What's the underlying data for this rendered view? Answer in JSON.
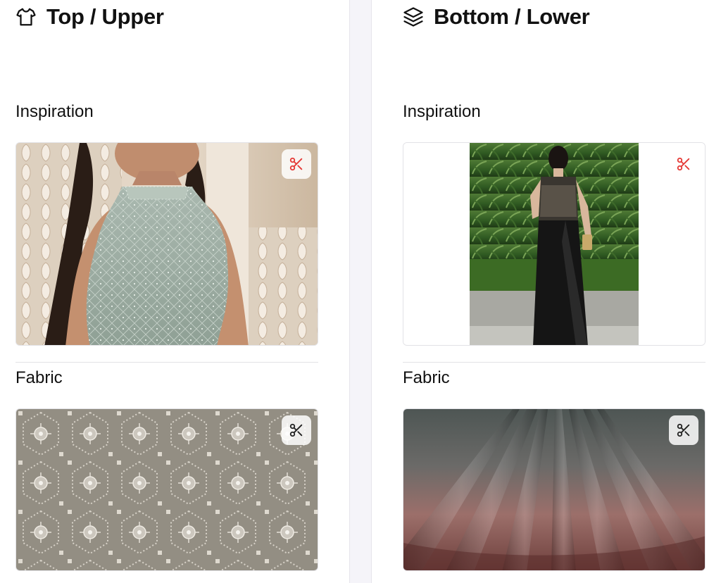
{
  "top": {
    "title": "Top / Upper",
    "icon": "shirt-icon",
    "inspiration_label": "Inspiration",
    "fabric_label": "Fabric"
  },
  "bottom": {
    "title": "Bottom / Lower",
    "icon": "layers-icon",
    "inspiration_label": "Inspiration",
    "fabric_label": "Fabric"
  },
  "colors": {
    "accent_red": "#e53935",
    "divider": "#f5f4f9"
  }
}
